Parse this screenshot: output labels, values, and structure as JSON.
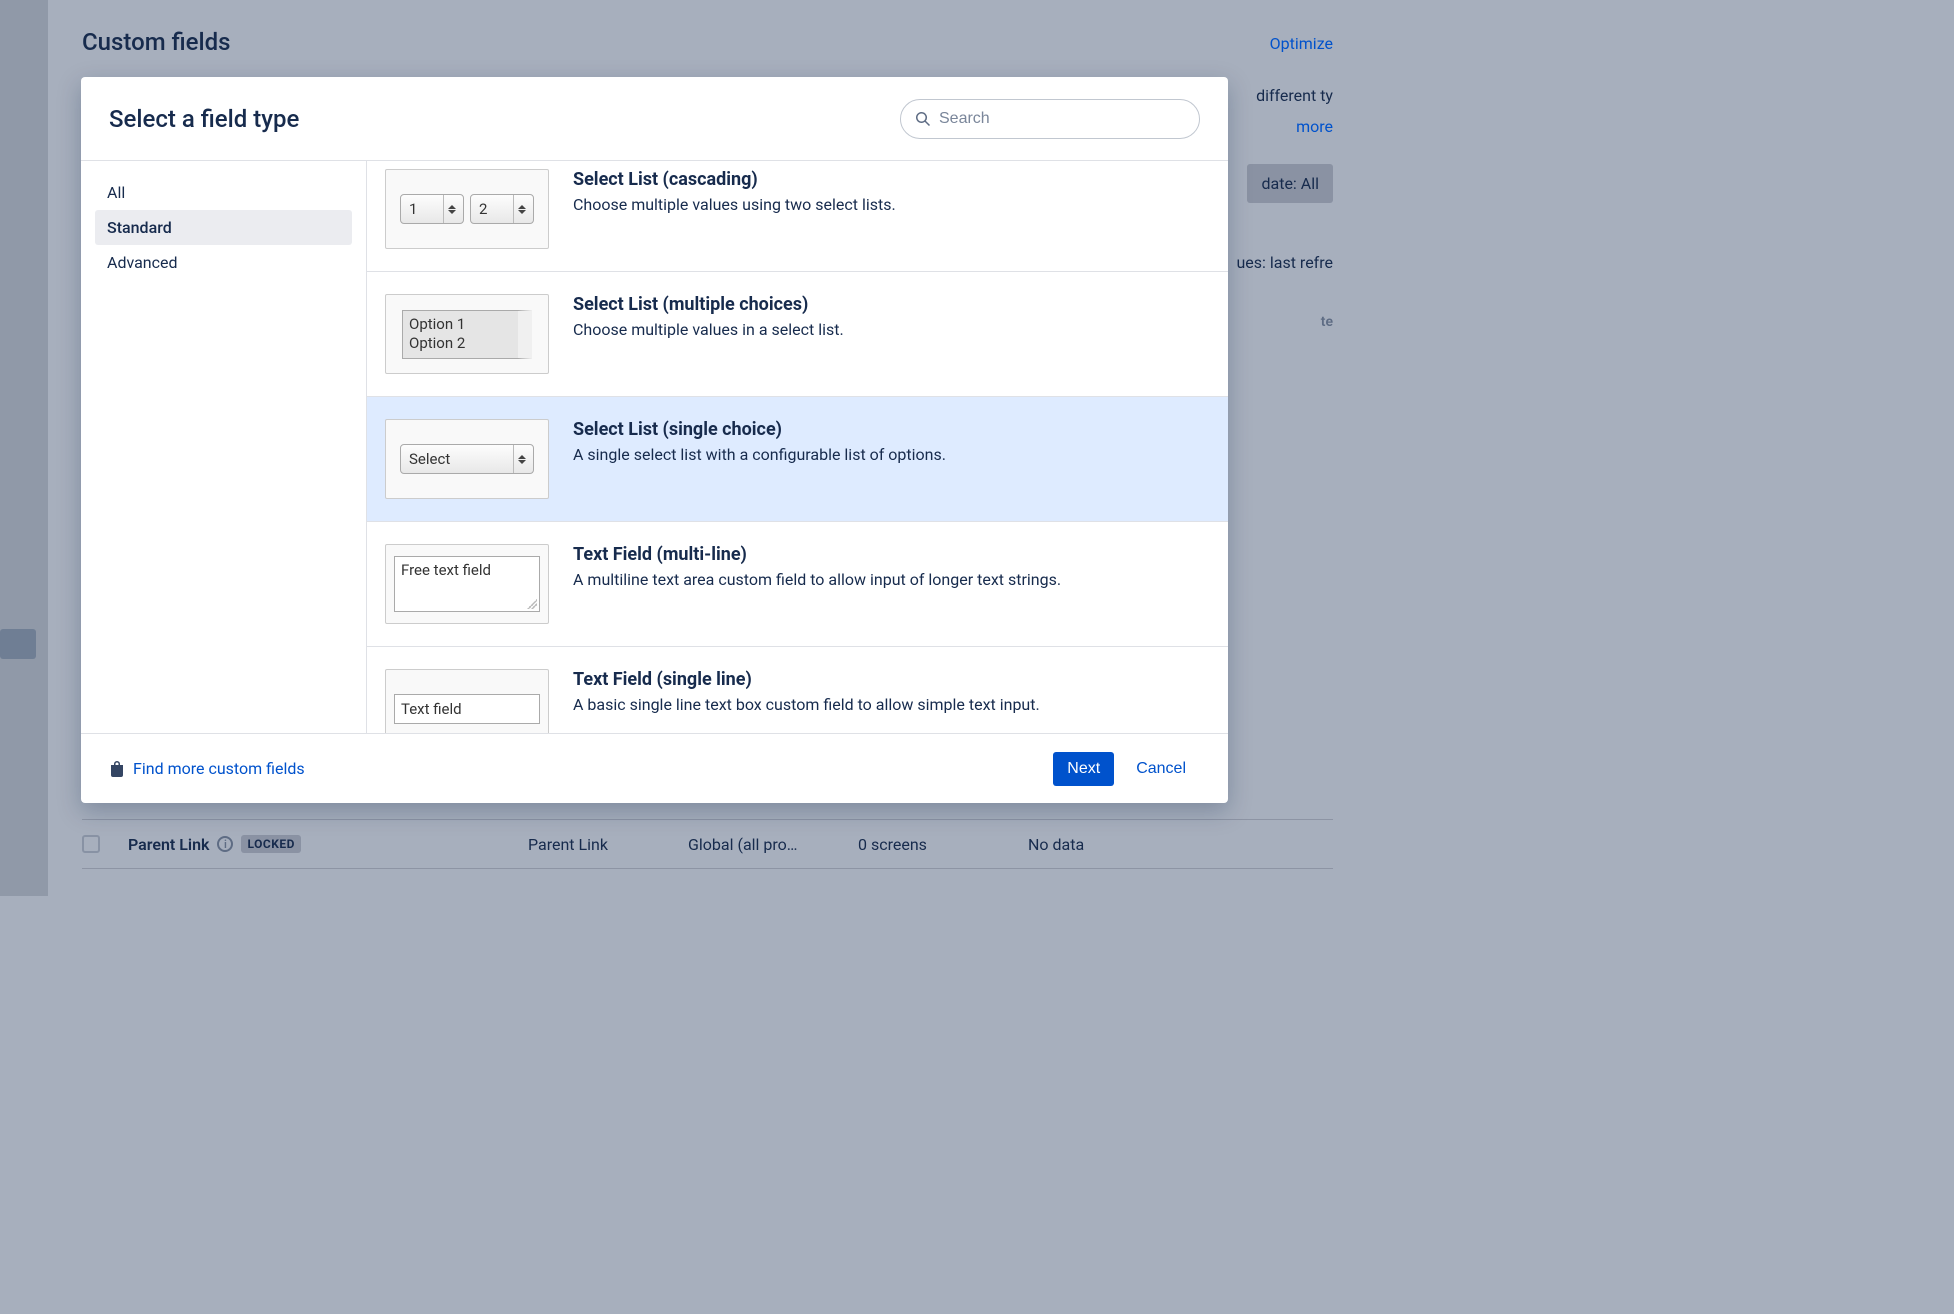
{
  "background": {
    "page_title": "Custom fields",
    "optimize_link": "Optimize",
    "right_text1": "different ty",
    "right_text2": "more",
    "filter_chip": "date: All",
    "right_text3": "ues: last refre",
    "right_text4": "te",
    "row": {
      "name": "Parent Link",
      "locked": "LOCKED",
      "col2": "Parent Link",
      "col3": "Global (all pro…",
      "col4": "0 screens",
      "col5": "No data"
    }
  },
  "modal": {
    "title": "Select a field type",
    "search_placeholder": "Search",
    "categories": [
      {
        "label": "All",
        "selected": false
      },
      {
        "label": "Standard",
        "selected": true
      },
      {
        "label": "Advanced",
        "selected": false
      }
    ],
    "field_types": [
      {
        "id": "cascading",
        "title": "Select List (cascading)",
        "desc": "Choose multiple values using two select lists.",
        "selected": false,
        "preview": {
          "kind": "two-selects",
          "a": "1",
          "b": "2"
        }
      },
      {
        "id": "multiselect",
        "title": "Select List (multiple choices)",
        "desc": "Choose multiple values in a select list.",
        "selected": false,
        "preview": {
          "kind": "listbox",
          "line1": "Option 1",
          "line2": "Option 2"
        }
      },
      {
        "id": "singleselect",
        "title": "Select List (single choice)",
        "desc": "A single select list with a configurable list of options.",
        "selected": true,
        "preview": {
          "kind": "select",
          "label": "Select"
        }
      },
      {
        "id": "textarea",
        "title": "Text Field (multi-line)",
        "desc": "A multiline text area custom field to allow input of longer text strings.",
        "selected": false,
        "preview": {
          "kind": "textarea",
          "text": "Free text field"
        }
      },
      {
        "id": "textfield",
        "title": "Text Field (single line)",
        "desc": "A basic single line text box custom field to allow simple text input.",
        "selected": false,
        "preview": {
          "kind": "input",
          "text": "Text field"
        }
      }
    ],
    "footer": {
      "find_more": "Find more custom fields",
      "next": "Next",
      "cancel": "Cancel"
    }
  }
}
